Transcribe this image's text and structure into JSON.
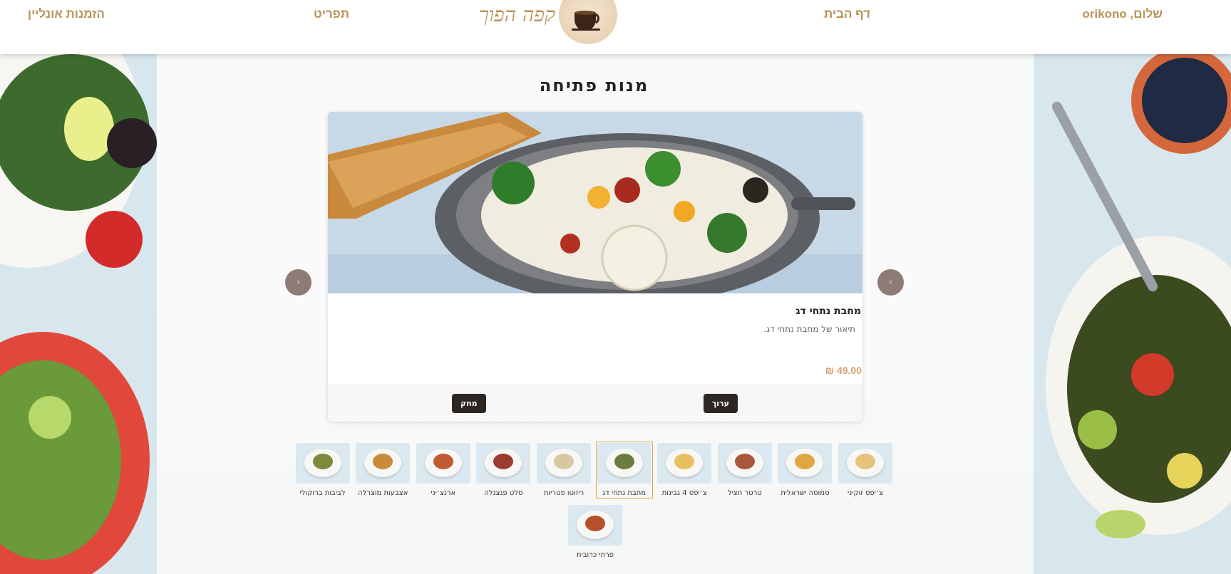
{
  "header": {
    "greeting": "שלום, orikono",
    "home_link": "דף הבית",
    "brand_name": "קפה הפוך",
    "menu_link": "תפריט",
    "orders_link": "הזמנות אונליין"
  },
  "page": {
    "title": "מנות פתיחה"
  },
  "carousel": {
    "current": {
      "name": "מחבת נתחי דג",
      "description": "תיאור של מחבת נתחי דג.",
      "price": "₪ 49.00"
    },
    "edit_label": "ערוך",
    "delete_label": "מחק",
    "prev_icon": "chevron-left-icon",
    "next_icon": "chevron-right-icon",
    "prev_glyph": "‹",
    "next_glyph": "›"
  },
  "thumbnails": [
    {
      "label": "צ׳יפס זוקיני",
      "food_color": "#e7c27a"
    },
    {
      "label": "סמוסה ישראלית",
      "food_color": "#e0a640"
    },
    {
      "label": "טרטר חציל",
      "food_color": "#a8573a"
    },
    {
      "label": "צ׳יפס 4 גבינות",
      "food_color": "#e9c061"
    },
    {
      "label": "מחבת נתחי דג",
      "food_color": "#6b7d3e",
      "active": true
    },
    {
      "label": "ריזוטו פטריות",
      "food_color": "#d8c8a2"
    },
    {
      "label": "סלט פנצנלה",
      "food_color": "#9a3c2e"
    },
    {
      "label": "ארנצ׳יני",
      "food_color": "#c05a30"
    },
    {
      "label": "אצבעות מוצרלה",
      "food_color": "#c98a3a"
    },
    {
      "label": "לביבות ברוקולי",
      "food_color": "#7e8a3a"
    },
    {
      "label": "פרחי כרובית",
      "food_color": "#b5502c"
    }
  ],
  "colors": {
    "accent": "#b8925a",
    "button_dark": "#2e2622",
    "price": "#d8a070",
    "active_thumb_border": "#e1a646",
    "arrow_bg": "#8e7b76"
  }
}
